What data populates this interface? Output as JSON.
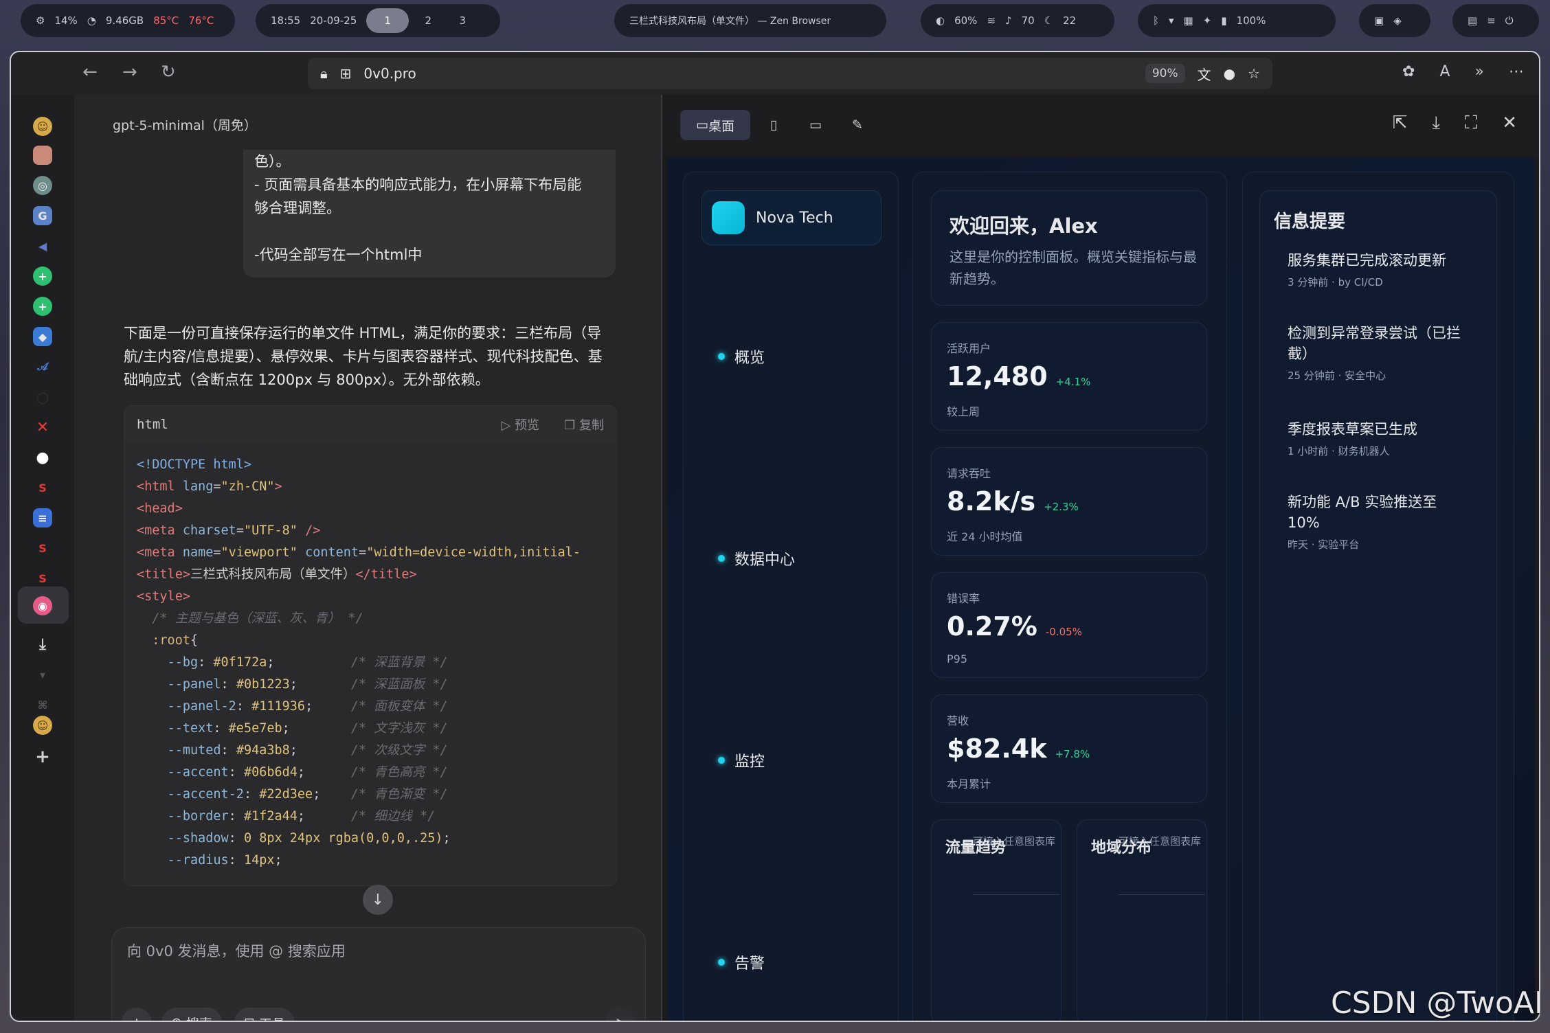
{
  "topbar": {
    "cpu": "14%",
    "mem": "9.46GB",
    "temp1": "85°C",
    "temp2": "76°C",
    "time": "18:55",
    "date": "20-09-25",
    "workspaces": [
      "1",
      "2",
      "3"
    ],
    "window_title": "三栏式科技风布局（单文件） — Zen Browser",
    "brightness": "60%",
    "volume": "70",
    "weather": "22",
    "battery": "100%"
  },
  "browser": {
    "url": "0v0.pro",
    "zoom": "90%"
  },
  "chat": {
    "model": "gpt-5-minimal（周免）",
    "bubble_lines": [
      "色）。",
      "- 页面需具备基本的响应式能力，在小屏幕下布局能",
      "够合理调整。",
      "",
      "-代码全部写在一个html中"
    ],
    "reply": "下面是一份可直接保存运行的单文件 HTML，满足你的要求：三栏布局（导航/主内容/信息提要）、悬停效果、卡片与图表容器样式、现代科技配色、基础响应式（含断点在 1200px 与 800px）。无外部依赖。",
    "code_lang": "html",
    "preview_label": "预览",
    "copy_label": "复制",
    "input_placeholder": "向 0v0 发消息，使用 @ 搜索应用",
    "search_label": "搜索",
    "tools_label": "工具"
  },
  "preview": {
    "tab_desktop": "桌面",
    "brand": "Nova Tech",
    "nav": [
      "概览",
      "数据中心",
      "监控",
      "告警"
    ],
    "welcome_title": "欢迎回来，Alex",
    "welcome_desc": "这里是你的控制面板。概览关键指标与最新趋势。",
    "stats": [
      {
        "label": "活跃用户",
        "value": "12,480",
        "delta": "+4.1%",
        "sub": "较上周"
      },
      {
        "label": "请求吞吐",
        "value": "8.2k/s",
        "delta": "+2.3%",
        "sub": "近 24 小时均值"
      },
      {
        "label": "错误率",
        "value": "0.27%",
        "delta": "-0.05%",
        "sub": "P95"
      },
      {
        "label": "营收",
        "value": "$82.4k",
        "delta": "+7.8%",
        "sub": "本月累计"
      }
    ],
    "charts": [
      {
        "title": "流量趋势",
        "lib": "可接入任意图表库"
      },
      {
        "title": "地域分布",
        "lib": "可接入任意图表库"
      }
    ],
    "info_title": "信息提要",
    "info": [
      {
        "title": "服务集群已完成滚动更新",
        "meta": "3 分钟前 · by CI/CD"
      },
      {
        "title": "检测到异常登录尝试（已拦截）",
        "meta": "25 分钟前 · 安全中心"
      },
      {
        "title": "季度报表草案已生成",
        "meta": "1 小时前 · 财务机器人"
      },
      {
        "title": "新功能 A/B 实验推送至 10%",
        "meta": "昨天 · 实验平台"
      }
    ]
  },
  "watermark": "CSDN @TwoAI"
}
